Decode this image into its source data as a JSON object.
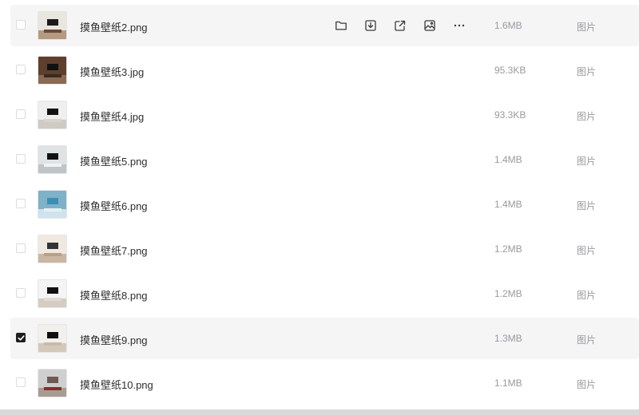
{
  "files": [
    {
      "name": "摸鱼壁纸2.png",
      "size": "1.6MB",
      "type": "图片",
      "checked": false,
      "hover": true,
      "thumb": {
        "wall": "#e9e5df",
        "floor": "#b49a82",
        "tv": "#1a1a1a",
        "cab": "#6b4a36"
      }
    },
    {
      "name": "摸鱼壁纸3.jpg",
      "size": "95.3KB",
      "type": "图片",
      "checked": false,
      "hover": false,
      "thumb": {
        "wall": "#5e3f2e",
        "floor": "#8a6a52",
        "tv": "#111111",
        "cab": "#3b2a20"
      }
    },
    {
      "name": "摸鱼壁纸4.jpg",
      "size": "93.3KB",
      "type": "图片",
      "checked": false,
      "hover": false,
      "thumb": {
        "wall": "#efefef",
        "floor": "#cfcac4",
        "tv": "#111111",
        "cab": "#d7d2cc"
      }
    },
    {
      "name": "摸鱼壁纸5.png",
      "size": "1.4MB",
      "type": "图片",
      "checked": false,
      "hover": false,
      "thumb": {
        "wall": "#dfe3e5",
        "floor": "#bfc4c7",
        "tv": "#111111",
        "cab": "#f2f2f2"
      }
    },
    {
      "name": "摸鱼壁纸6.png",
      "size": "1.4MB",
      "type": "图片",
      "checked": false,
      "hover": false,
      "thumb": {
        "wall": "#7fb2c8",
        "floor": "#cfe3ec",
        "tv": "#3a8fb4",
        "cab": "#e6eef2"
      }
    },
    {
      "name": "摸鱼壁纸7.png",
      "size": "1.2MB",
      "type": "图片",
      "checked": false,
      "hover": false,
      "thumb": {
        "wall": "#efe9e2",
        "floor": "#c9b7a4",
        "tv": "#333333",
        "cab": "#b8a08a"
      }
    },
    {
      "name": "摸鱼壁纸8.png",
      "size": "1.2MB",
      "type": "图片",
      "checked": false,
      "hover": false,
      "thumb": {
        "wall": "#f4f4f4",
        "floor": "#d6cdc2",
        "tv": "#0f0f0f",
        "cab": "#e3dbd2"
      }
    },
    {
      "name": "摸鱼壁纸9.png",
      "size": "1.3MB",
      "type": "图片",
      "checked": true,
      "hover": false,
      "thumb": {
        "wall": "#f2f0ec",
        "floor": "#d3c8bb",
        "tv": "#0f0f0f",
        "cab": "#c9bba9"
      }
    },
    {
      "name": "摸鱼壁纸10.png",
      "size": "1.1MB",
      "type": "图片",
      "checked": false,
      "hover": false,
      "thumb": {
        "wall": "#cfcfcf",
        "floor": "#a89c92",
        "tv": "#6d5a52",
        "cab": "#8b2c2c"
      }
    }
  ],
  "row_actions": [
    {
      "icon": "folder-icon"
    },
    {
      "icon": "download-icon"
    },
    {
      "icon": "share-icon"
    },
    {
      "icon": "image-preview-icon"
    },
    {
      "icon": "more-icon"
    }
  ],
  "colors": {
    "icon": "#3a3a3a",
    "muted": "#9a9a9e",
    "hover_bg": "#f5f5f6"
  }
}
